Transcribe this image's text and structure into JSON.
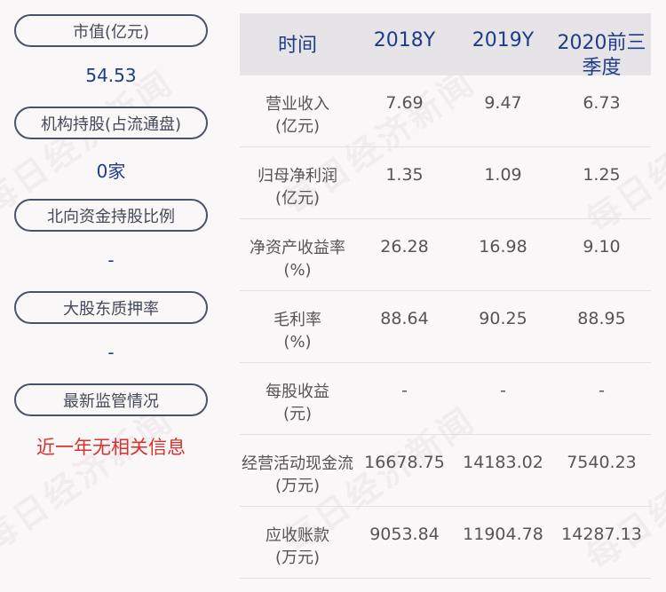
{
  "watermark": "每日经济新闻",
  "left": {
    "items": [
      {
        "label": "市值(亿元)",
        "value": "54.53"
      },
      {
        "label": "机构持股(占流通盘)",
        "value": "0家"
      },
      {
        "label": "北向资金持股比例",
        "value": "-"
      },
      {
        "label": "大股东质押率",
        "value": "-"
      },
      {
        "label": "最新监管情况",
        "value": "近一年无相关信息"
      }
    ]
  },
  "table": {
    "headers": [
      "时间",
      "2018Y",
      "2019Y",
      "2020前三季度"
    ],
    "rows": [
      {
        "label1": "营业收入",
        "label2": "(亿元)",
        "values": [
          "7.69",
          "9.47",
          "6.73"
        ]
      },
      {
        "label1": "归母净利润",
        "label2": "(亿元)",
        "values": [
          "1.35",
          "1.09",
          "1.25"
        ]
      },
      {
        "label1": "净资产收益率",
        "label2": "(%)",
        "values": [
          "26.28",
          "16.98",
          "9.10"
        ]
      },
      {
        "label1": "毛利率",
        "label2": "(%)",
        "values": [
          "88.64",
          "90.25",
          "88.95"
        ]
      },
      {
        "label1": "每股收益",
        "label2": "(元)",
        "values": [
          "-",
          "-",
          "-"
        ]
      },
      {
        "label1": "经营活动现金流",
        "label2": "(万元)",
        "values": [
          "16678.75",
          "14183.02",
          "7540.23"
        ]
      },
      {
        "label1": "应收账款",
        "label2": "(万元)",
        "values": [
          "9053.84",
          "11904.78",
          "14287.13"
        ]
      }
    ]
  },
  "colors": {
    "value_blue": "#1f3c88",
    "alert_red": "#d9322c",
    "header_bg": "#e6e4e6",
    "pill_border": "#4a5368"
  }
}
